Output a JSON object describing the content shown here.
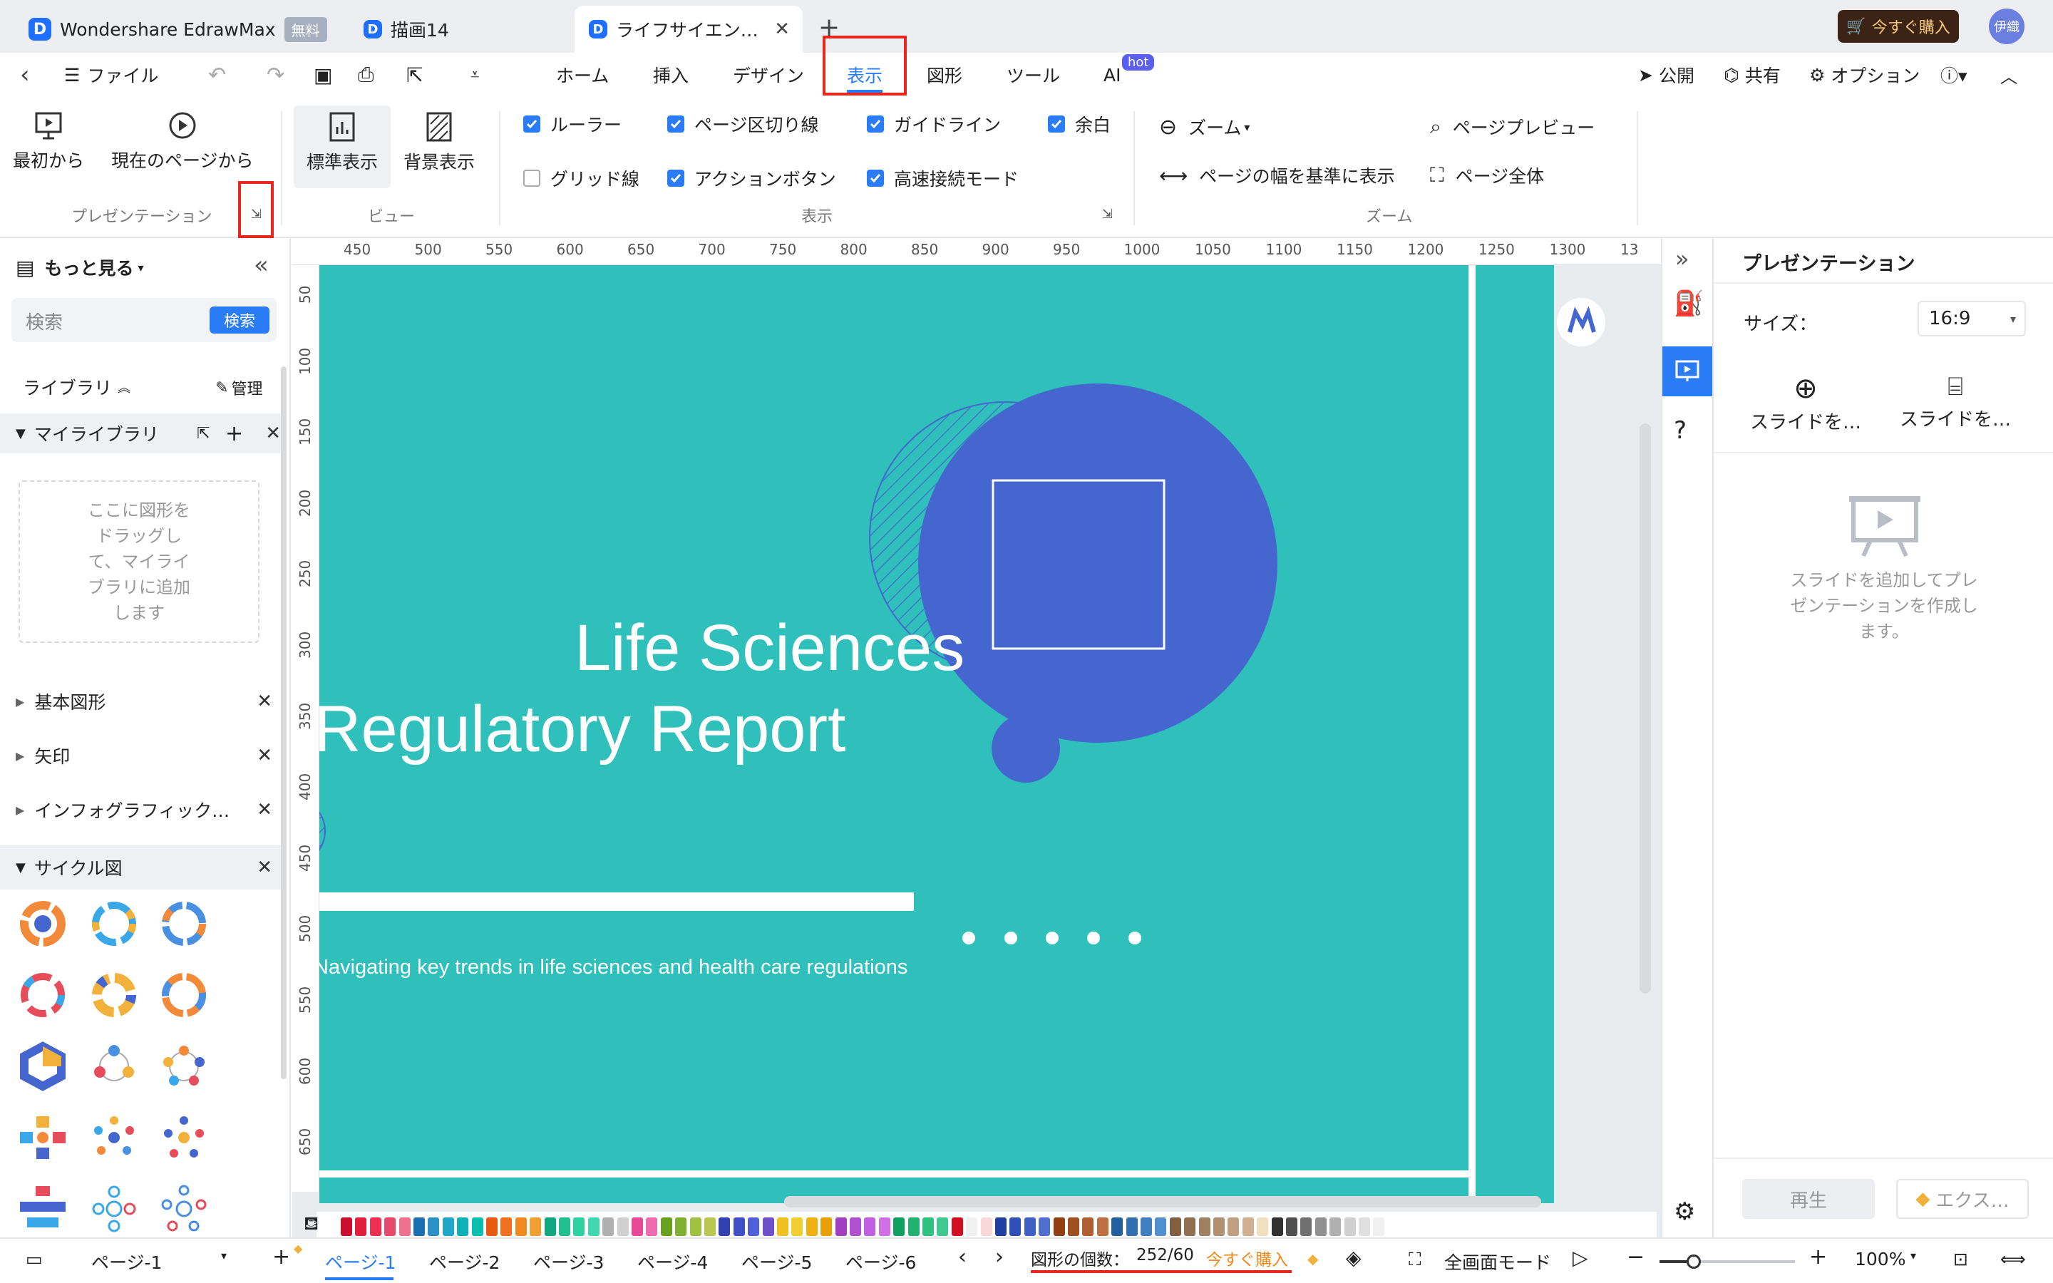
{
  "tabs": {
    "app_name": "Wondershare EdrawMax",
    "free_badge": "無料",
    "doc1": "描画14",
    "doc2": "ライフサイエン…",
    "buy_now": "今すぐ購入",
    "user": "伊織"
  },
  "menu": {
    "file": "ファイル",
    "items": [
      "ホーム",
      "挿入",
      "デザイン",
      "表示",
      "図形",
      "ツール",
      "AI"
    ],
    "ai_badge": "hot",
    "publish": "公開",
    "share": "共有",
    "options": "オプション"
  },
  "ribbon": {
    "from_start": "最初から",
    "from_current": "現在のページから",
    "presentation_group": "プレゼンテーション",
    "standard_view": "標準表示",
    "background_view": "背景表示",
    "view_group": "ビュー",
    "checks": [
      {
        "label": "ルーラー",
        "checked": true
      },
      {
        "label": "ページ区切り線",
        "checked": true
      },
      {
        "label": "ガイドライン",
        "checked": true
      },
      {
        "label": "余白",
        "checked": true
      },
      {
        "label": "グリッド線",
        "checked": false
      },
      {
        "label": "アクションボタン",
        "checked": true
      },
      {
        "label": "高速接続モード",
        "checked": true
      }
    ],
    "display_group": "表示",
    "zoom": "ズーム",
    "fit_width": "ページの幅を基準に表示",
    "page_preview": "ページプレビュー",
    "whole_page": "ページ全体",
    "zoom_group": "ズーム"
  },
  "left": {
    "more": "もっと見る",
    "search_placeholder": "検索",
    "search_button": "検索",
    "library": "ライブラリ",
    "manage": "管理",
    "my_library": "マイライブラリ",
    "drop_hint_lines": [
      "ここに図形を",
      "ドラッグし",
      "て、マイライ",
      "ブラリに追加",
      "します"
    ],
    "categories": [
      "基本図形",
      "矢印",
      "インフォグラフィック…",
      "サイクル図"
    ]
  },
  "ruler": {
    "top": [
      "450",
      "500",
      "550",
      "600",
      "650",
      "700",
      "750",
      "800",
      "850",
      "900",
      "950",
      "1000",
      "1050",
      "1100",
      "1150",
      "1200",
      "1250",
      "1300",
      "13"
    ],
    "left": [
      "50",
      "100",
      "150",
      "200",
      "250",
      "300",
      "350",
      "400",
      "450",
      "500",
      "550",
      "600",
      "650"
    ]
  },
  "slide": {
    "title_line1": "Life Sciences",
    "title_line2": "Regulatory Report",
    "subtitle": "Navigating key trends in life sciences and health care regulations",
    "bg_color": "#2fc0bb",
    "circle_color": "#4566cf"
  },
  "right": {
    "panel_title": "プレゼンテーション",
    "size_label": "サイズ：",
    "size_value": "16:9",
    "add_slide": "スライドを…",
    "slide_from": "スライドを…",
    "empty_lines": [
      "スライドを追加してプレ",
      "ゼンテーションを作成し",
      "ます。"
    ],
    "play": "再生",
    "export": "エクス…"
  },
  "status": {
    "page_selector": "ページ-1",
    "pages": [
      "ページ-1",
      "ページ-2",
      "ページ-3",
      "ページ-4",
      "ページ-5",
      "ページ-6"
    ],
    "shape_count_label": "図形の個数：",
    "shape_count": "252/60",
    "buy": "今すぐ購入",
    "fullscreen": "全画面モード",
    "zoom": "100%"
  },
  "colors": {
    "accent": "#2a7cf6",
    "highlight_box": "#e8281e",
    "buy_button": "#3b2416"
  }
}
